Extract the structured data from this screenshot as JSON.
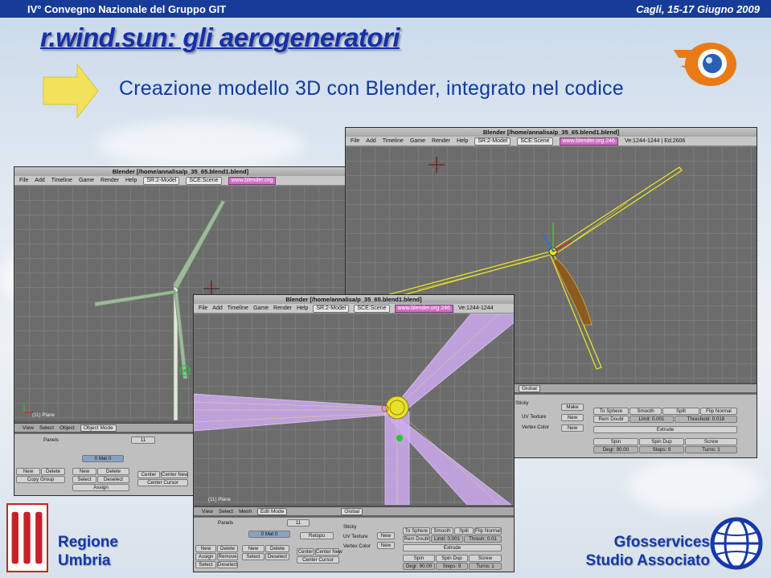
{
  "header": {
    "left": "IV° Convegno Nazionale del Gruppo GIT",
    "right": "Cagli, 15-17 Giugno 2009"
  },
  "title": "r.wind.sun: gli aerogeneratori",
  "subtitle": "Creazione modello 3D con Blender, integrato nel codice",
  "window_left": {
    "title": "Blender [/home/annalisa/p_35_65.blend1.blend]",
    "menu": [
      "File",
      "Add",
      "Timeline",
      "Game",
      "Render",
      "Help"
    ],
    "screen_field": "SR:2-Model",
    "scene_field": "SCE:Scene",
    "url": "www.blender.org",
    "plane_label": "(11) Plane",
    "header": {
      "view": "View",
      "select": "Select",
      "object": "Object",
      "mode": "Object Mode"
    },
    "panels": "Panels",
    "frame": "11",
    "mat": "0 Mat 0",
    "buttons": {
      "new": "New",
      "delete": "Delete",
      "copy_group": "Copy Group",
      "new2": "New",
      "delete2": "Delete",
      "select": "Select",
      "deselect": "Deselect",
      "assign": "Assign",
      "center": "Center",
      "center_new": "Center New",
      "center_cursor": "Center Cursor"
    }
  },
  "window_right": {
    "title": "Blender [/home/annalisa/p_35_65.blend1.blend]",
    "menu": [
      "File",
      "Add",
      "Timeline",
      "Game",
      "Render",
      "Help"
    ],
    "screen_field": "SR:2-Model",
    "scene_field": "SCE:Scene",
    "url": "www.blender.org 246",
    "stats": "Ve:1244-1244 | Ed:2606",
    "hdr": {
      "global": "Global"
    },
    "buttons": {
      "make": "Make",
      "to_sphere": "To Sphere",
      "smooth": "Smooth",
      "split": "Split",
      "flip_normal": "Flip Normal",
      "rem_doubl": "Rem Doubl",
      "limit": "Limit: 0.001",
      "threshold": "Threshold: 0.018",
      "uv_texture": "UV Texture",
      "vertex_color": "Vertex Color",
      "new": "New",
      "new2": "New",
      "extrude": "Extrude",
      "spin": "Spin",
      "spin_dup": "Spin Dup",
      "screw": "Screw",
      "degr": "Degr: 90.00",
      "steps": "Steps: 9",
      "turns": "Turns: 1",
      "sticky": "Sticky"
    }
  },
  "window_front": {
    "title": "Blender [/home/annalisa/p_35_65.blend1.blend]",
    "menu": [
      "File",
      "Add",
      "Timeline",
      "Game",
      "Render",
      "Help"
    ],
    "screen_field": "SR:2-Model",
    "scene_field": "SCE:Scene",
    "url": "www.blender.org 246",
    "stats": "Ve:1244-1244",
    "plane_label": "(11) Plane",
    "header": {
      "view": "View",
      "select": "Select",
      "mesh": "Mesh",
      "mode": "Edit Mode",
      "global": "Global"
    },
    "panels": "Panels",
    "frame": "11",
    "mat": "0 Mat 0",
    "buttons": {
      "new": "New",
      "delete": "Delete",
      "assign": "Assign",
      "remove": "Remove",
      "select": "Select",
      "deselect": "Deselect",
      "select2": "Select",
      "deselect2": "Deselect",
      "new2": "New",
      "delete2": "Delete",
      "retopo": "Retopo",
      "center": "Center",
      "center_new": "Center New",
      "center_cursor": "Center Cursor",
      "uv_texture": "UV Texture",
      "vertex_color": "Vertex Color",
      "new3": "New",
      "new4": "New",
      "sticky": "Sticky",
      "to_sphere": "To Sphere",
      "smooth": "Smooth",
      "split": "Split",
      "flip_normal": "Flip Normal",
      "rem_doubl": "Rem Doubl",
      "limit": "Limit: 0.001",
      "threshold": "Thresh: 0.01",
      "extrude": "Extrude",
      "spin": "Spin",
      "spin_dup": "Spin Dup",
      "screw": "Screw",
      "degr": "Degr: 90.00",
      "steps": "Steps: 9",
      "turns": "Turns: 1"
    }
  },
  "footer": {
    "left_line1": "Regione",
    "left_line2": "Umbria",
    "right_line1": "Gfosservices",
    "right_line2": "Studio Associato"
  },
  "colors": {
    "header_bar": "#173c97",
    "title": "#1630a8",
    "arrow": "#f2e15a",
    "wire_yellow": "#e6e22a",
    "wire_purple": "#c2a8e6"
  }
}
